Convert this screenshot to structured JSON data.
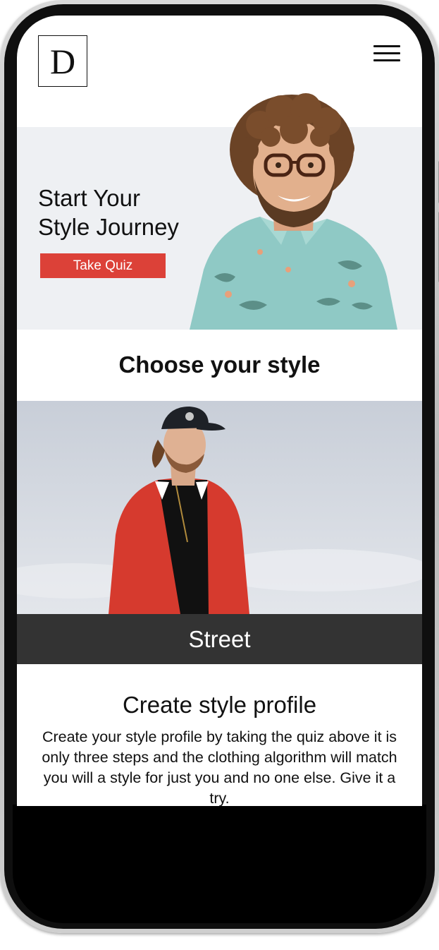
{
  "brand": {
    "logo_letter": "D"
  },
  "header": {
    "menu_icon": "hamburger-menu-icon"
  },
  "hero": {
    "title_line1": "Start Your",
    "title_line2": "Style Journey",
    "button_label": "Take Quiz",
    "button_color": "#dc4138",
    "background_color": "#eef0f3"
  },
  "styles": {
    "heading": "Choose your style",
    "card": {
      "label": "Street",
      "label_bar_color": "#333333"
    }
  },
  "profile": {
    "heading": "Create style profile",
    "body": "Create your style profile by taking the quiz above it is only three steps and the clothing algorithm will match you will a style for just you and no one else. Give it a try."
  }
}
